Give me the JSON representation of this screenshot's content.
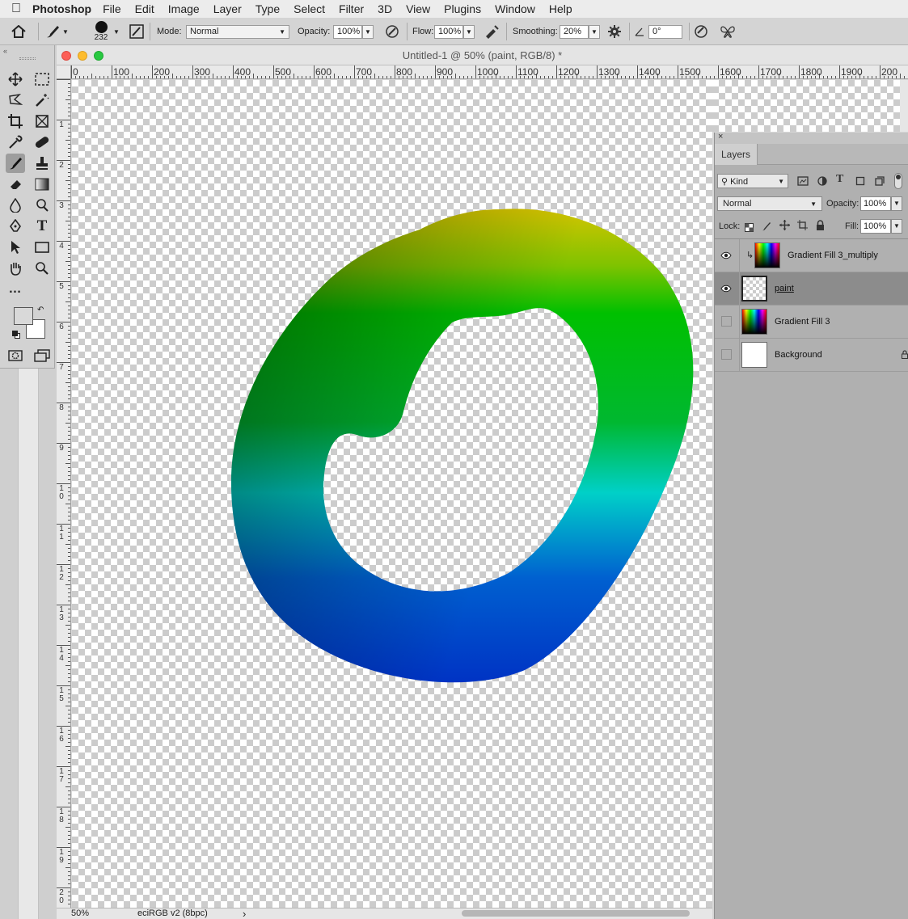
{
  "menubar": {
    "app_name": "Photoshop",
    "items": [
      "File",
      "Edit",
      "Image",
      "Layer",
      "Type",
      "Select",
      "Filter",
      "3D",
      "View",
      "Plugins",
      "Window",
      "Help"
    ]
  },
  "options_bar": {
    "brush_size": "232",
    "mode_label": "Mode:",
    "mode_value": "Normal",
    "opacity_label": "Opacity:",
    "opacity_value": "100%",
    "flow_label": "Flow:",
    "flow_value": "100%",
    "smoothing_label": "Smoothing:",
    "smoothing_value": "20%",
    "angle_value": "0°"
  },
  "document": {
    "title": "Untitled-1 @ 50% (paint, RGB/8) *",
    "zoom": "50%",
    "profile": "eciRGB v2 (8bpc)",
    "status_arrow": "›"
  },
  "rulers": {
    "top": [
      "0",
      "100",
      "200",
      "300",
      "400",
      "500",
      "600",
      "700",
      "800",
      "900",
      "1000",
      "1100",
      "1200",
      "1300",
      "1400",
      "1500",
      "1600",
      "1700",
      "1800",
      "1900",
      "200"
    ],
    "left": [
      "1",
      "2",
      "3",
      "4",
      "5",
      "6",
      "7",
      "8",
      "9",
      "10",
      "11",
      "12",
      "13",
      "14",
      "15",
      "16",
      "17",
      "18",
      "19",
      "20"
    ]
  },
  "layers_panel": {
    "tab_label": "Layers",
    "filter_kind": "Kind",
    "blend_mode": "Normal",
    "opacity_label": "Opacity:",
    "opacity_value": "100%",
    "lock_label": "Lock:",
    "fill_label": "Fill:",
    "fill_value": "100%",
    "layers": [
      {
        "name": "Gradient Fill 3_multiply",
        "visible": true,
        "clipped": true,
        "thumb": "rainbow"
      },
      {
        "name": "paint",
        "visible": true,
        "selected": true,
        "thumb": "checker"
      },
      {
        "name": "Gradient Fill 3",
        "visible": false,
        "thumb": "rainbow"
      },
      {
        "name": "Background",
        "visible": false,
        "locked": true,
        "thumb": "white"
      }
    ]
  },
  "colors": {
    "foreground": "#d9d9d9",
    "background": "#ffffff",
    "ring_top": "#d4c400",
    "ring_green": "#00c000",
    "ring_dark_green": "#007a00",
    "ring_cyan": "#00d0c8",
    "ring_blue": "#0033c4",
    "ring_navy": "#001a80"
  }
}
